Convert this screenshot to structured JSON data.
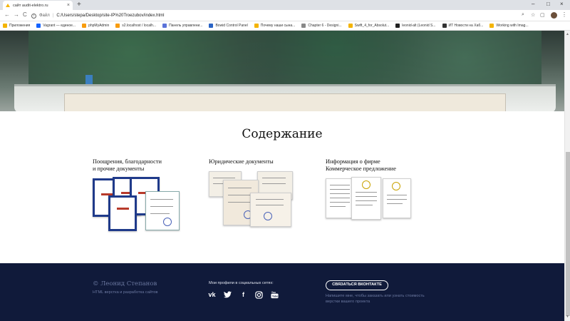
{
  "browser": {
    "tab_title": "сайт audit-elektro.ru",
    "tab_close": "×",
    "new_tab": "+",
    "window_controls": [
      "–",
      "□",
      "×"
    ],
    "nav": {
      "back": "←",
      "forward": "→",
      "reload": "C"
    },
    "url_scheme": "Файл",
    "url_separator": "|",
    "url": "C:/Users/stepa/Desktop/site-IP%20Troezubov/index.html",
    "menu": "⋮",
    "bookmarks": [
      {
        "label": "Приложения",
        "color": "#f4b400"
      },
      {
        "label": "Vagrant — единое...",
        "color": "#1563ff"
      },
      {
        "label": "phpMyAdmin",
        "color": "#f89c0e"
      },
      {
        "label": "s2.localhost / localh...",
        "color": "#f89c0e"
      },
      {
        "label": "Панель управлени...",
        "color": "#5b73d9"
      },
      {
        "label": "Bowid Control Panel",
        "color": "#2a64c5"
      },
      {
        "label": "Почему наши сына...",
        "color": "#f4b400"
      },
      {
        "label": "Chapter 6 - Designi...",
        "color": "#888888"
      },
      {
        "label": "Swift_4_for_Absolut...",
        "color": "#f4b400"
      },
      {
        "label": "leonid-alt (Leonid S...",
        "color": "#222222"
      },
      {
        "label": "ИТ Новости на Хаб...",
        "color": "#333333"
      },
      {
        "label": "Working with Imag...",
        "color": "#f4b400"
      }
    ]
  },
  "page": {
    "section_title": "Содержание",
    "cards": [
      {
        "title_line1": "Поощрения, благодарности",
        "title_line2": "и прочие документы"
      },
      {
        "title_line1": "Юридические документы",
        "title_line2": ""
      },
      {
        "title_line1": "Информация о фирме",
        "title_line2": "Коммерческое предложение"
      }
    ]
  },
  "footer": {
    "author_name": "© Леонид Степанов",
    "author_subtitle": "HTML верстка и разработка сайтов",
    "social_title": "Мои профили в социальных сетях:",
    "social_icons": [
      "vk-icon",
      "twitter-icon",
      "facebook-icon",
      "instagram-icon",
      "youtube-icon"
    ],
    "cta_label": "СВЯЗАТЬСЯ ВКОНТАКТЕ",
    "cta_note": "Напишите мне, чтобы заказать или узнать стоимость верстки вашего проекта"
  },
  "colors": {
    "footer_bg": "#101a3a",
    "footer_muted": "#6b78a0",
    "diploma_blue": "#1f3a8a"
  }
}
